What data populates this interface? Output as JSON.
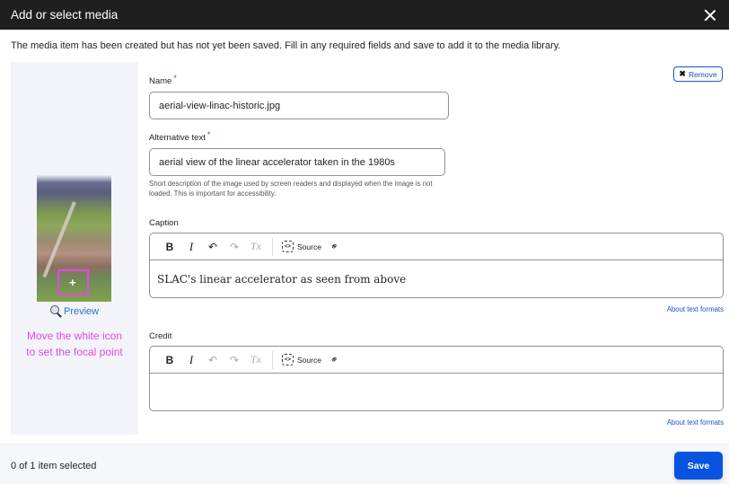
{
  "dialog": {
    "title": "Add or select media",
    "close_icon": "close-icon"
  },
  "message": "The media item has been created but has not yet been saved. Fill in any required fields and save to add it to the media library.",
  "media": {
    "preview_label": "Preview",
    "preview_icon": "magnifier-icon",
    "focal_help": "Move the white icon to set the focal point",
    "focal_help_line1": "Move the white icon",
    "focal_help_line2": "to set the focal point",
    "focal_color": "#e449e4",
    "remove_label": "Remove"
  },
  "form": {
    "name": {
      "label": "Name",
      "required": "*",
      "value": "aerial-view-linac-historic.jpg"
    },
    "alt_text": {
      "label": "Alternative text",
      "required": "*",
      "value": "aerial view of the linear accelerator taken in the 1980s",
      "description": "Short description of the image used by screen readers and displayed when the image is not loaded. This is important for accessibility."
    },
    "caption": {
      "label": "Caption",
      "value": "SLAC's linear accelerator as seen from above",
      "about_link": "About text formats"
    },
    "credit": {
      "label": "Credit",
      "value": "",
      "about_link": "About text formats"
    },
    "toolbar": {
      "bold": "B",
      "italic": "I",
      "undo": "↶",
      "redo": "↷",
      "clear_format": "Tx",
      "source": "Source",
      "link": "⊘"
    }
  },
  "footer": {
    "selection_count": "0 of 1 item selected",
    "save_label": "Save",
    "accent": "#0a52e0"
  }
}
